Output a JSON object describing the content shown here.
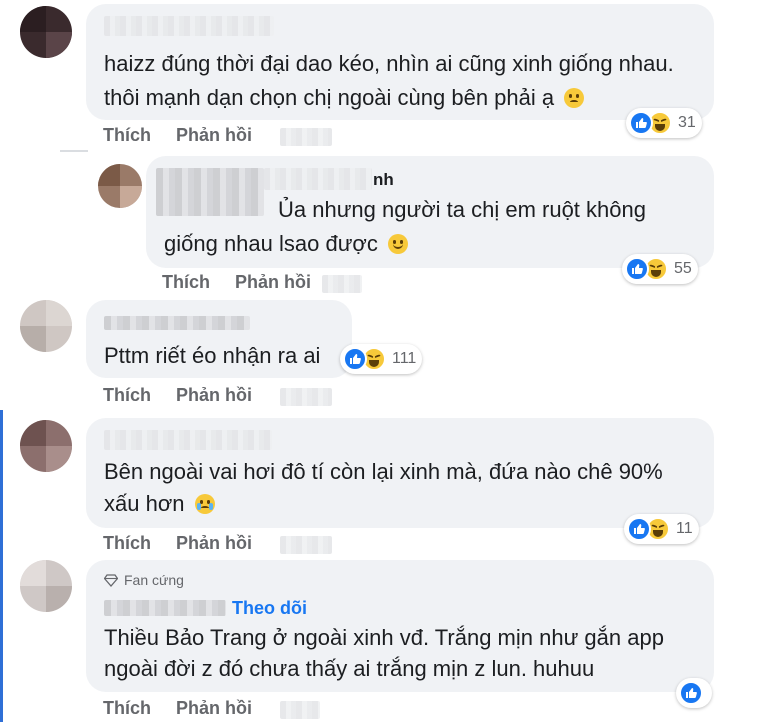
{
  "actions": {
    "like": "Thích",
    "reply": "Phản hồi"
  },
  "comments": [
    {
      "lines": [
        "haizz đúng thời đại dao kéo, nhìn ai cũng xinh giống nhau.",
        "thôi mạnh dạn chọn chị ngoài cùng bên phải ạ"
      ],
      "emoji": "sad-face",
      "reactions": {
        "types": [
          "like",
          "haha"
        ],
        "count": "31"
      }
    },
    {
      "name_suffix": "nh",
      "lines": [
        "Ủa nhưng người ta chị em ruột không",
        "giống nhau lsao được"
      ],
      "emoji": "smile-face",
      "reactions": {
        "types": [
          "like",
          "haha"
        ],
        "count": "55"
      }
    },
    {
      "lines": [
        "Pttm riết éo nhận ra ai"
      ],
      "reactions": {
        "types": [
          "like",
          "haha"
        ],
        "count": "111"
      }
    },
    {
      "lines": [
        "Bên ngoài vai hơi đô tí còn lại xinh mà, đứa nào chê 90%",
        "xấu hơn"
      ],
      "emoji": "crying-face",
      "reactions": {
        "types": [
          "like",
          "haha"
        ],
        "count": "11"
      }
    },
    {
      "badge": "Fan cứng",
      "badge_icon": "diamond-icon",
      "follow": "Theo dõi",
      "lines": [
        "Thiều Bảo Trang ở ngoài xinh vđ. Trắng mịn như gắn app",
        "ngoài đời z đó chưa thấy ai trắng mịn z lun. huhuu"
      ],
      "reactions": {
        "types": [
          "like"
        ],
        "count": ""
      }
    }
  ],
  "colors": {
    "bubble": "#f0f2f5",
    "meta": "#65676b",
    "accent": "#1877f2",
    "text": "#1c1e21"
  }
}
